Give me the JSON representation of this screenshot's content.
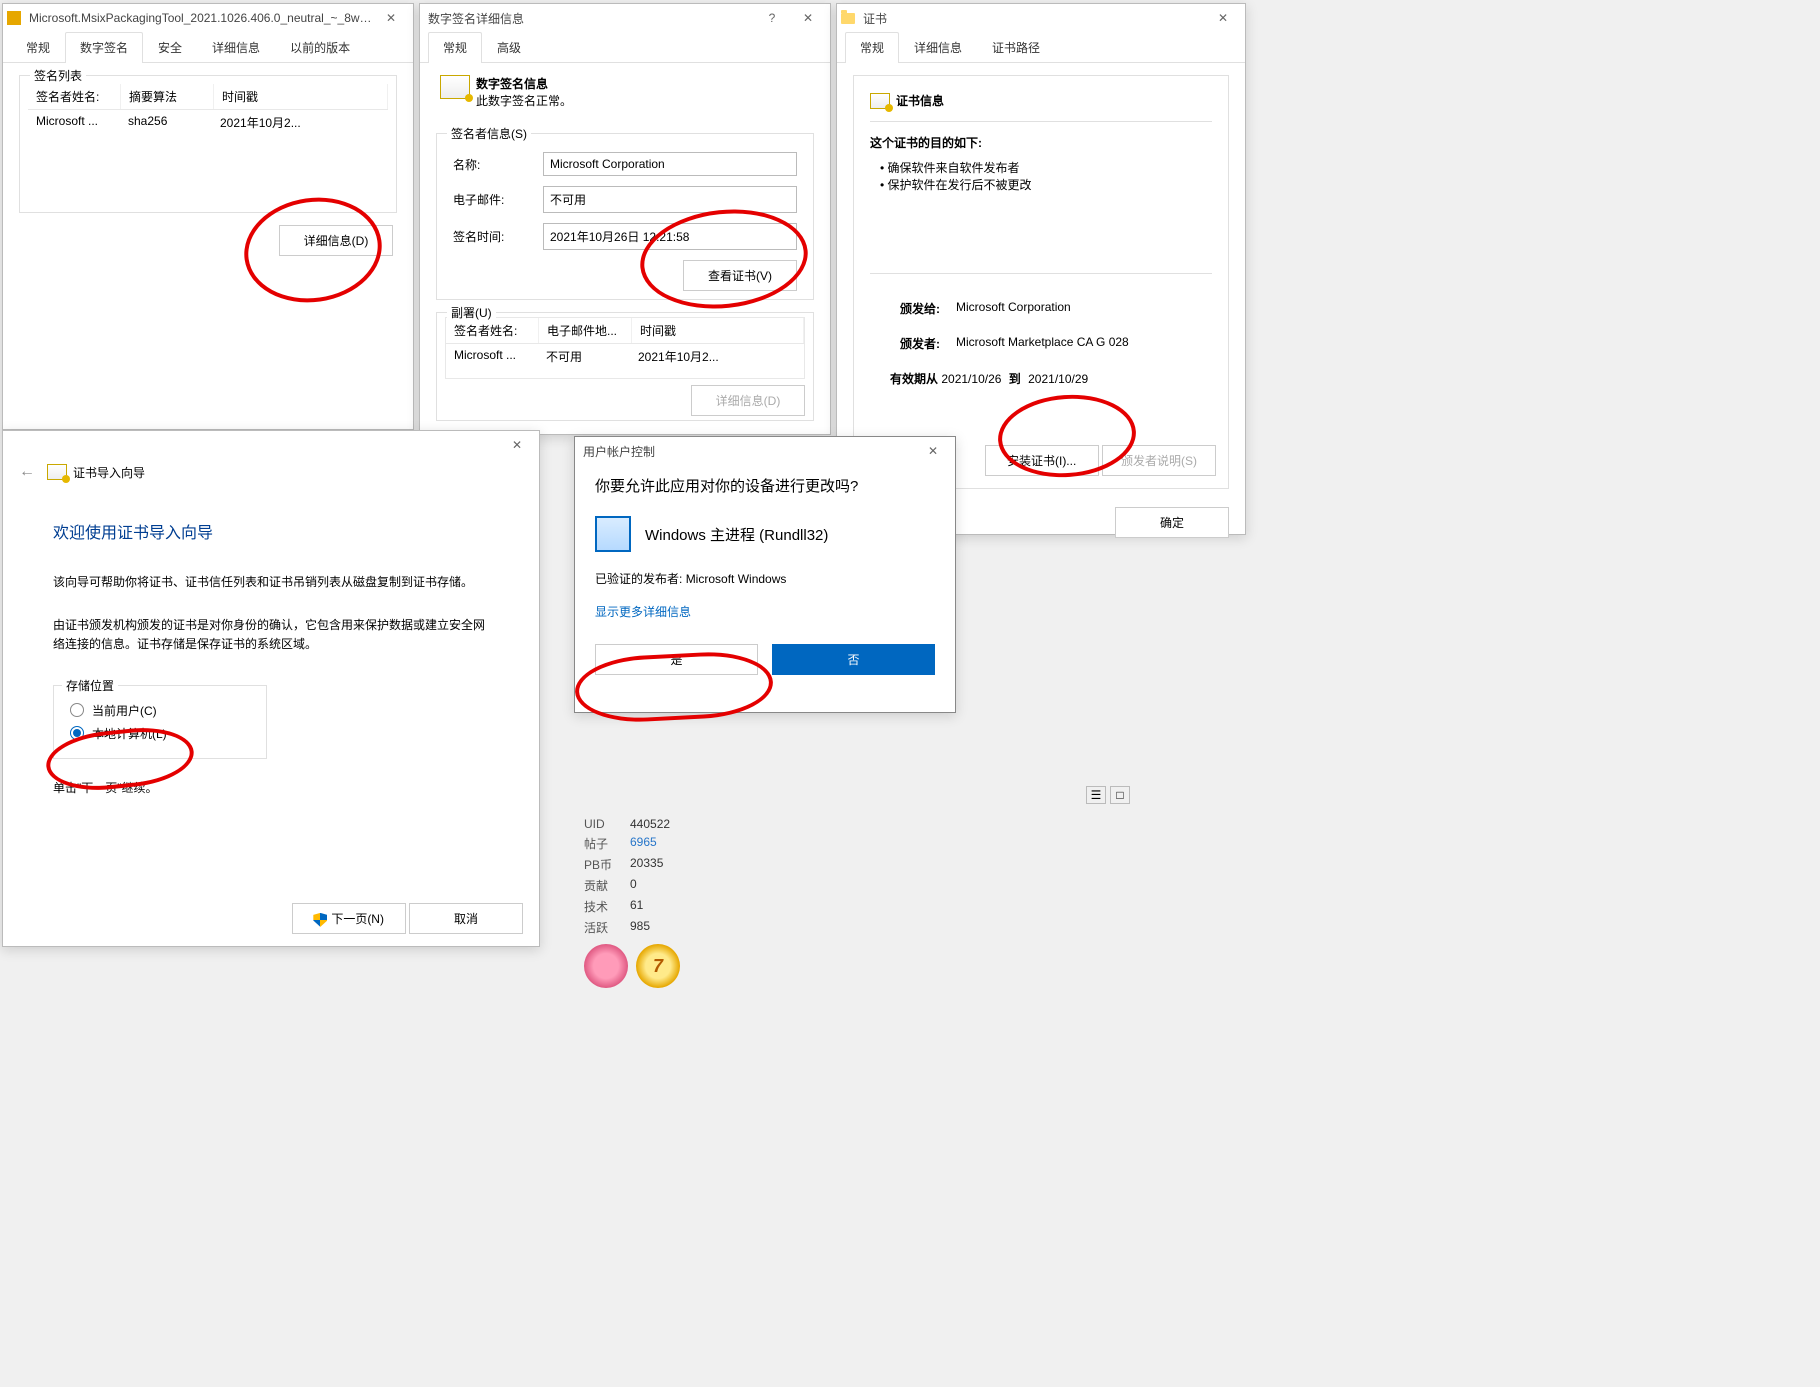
{
  "win1": {
    "title": "Microsoft.MsixPackagingTool_2021.1026.406.0_neutral_~_8wekyb3d8...",
    "tabs": [
      "常规",
      "数字签名",
      "安全",
      "详细信息",
      "以前的版本"
    ],
    "active_tab": 1,
    "group_title": "签名列表",
    "headers": [
      "签名者姓名:",
      "摘要算法",
      "时间戳"
    ],
    "row": [
      "Microsoft ...",
      "sha256",
      "2021年10月2..."
    ],
    "details_btn": "详细信息(D)"
  },
  "win2": {
    "title": "数字签名详细信息",
    "tabs": [
      "常规",
      "高级"
    ],
    "info_title": "数字签名信息",
    "info_text": "此数字签名正常。",
    "signer_group": "签名者信息(S)",
    "name_label": "名称:",
    "name_val": "Microsoft Corporation",
    "email_label": "电子邮件:",
    "email_val": "不可用",
    "time_label": "签名时间:",
    "time_val": "2021年10月26日 12:21:58",
    "view_cert_btn": "查看证书(V)",
    "counter_group": "副署(U)",
    "counter_headers": [
      "签名者姓名:",
      "电子邮件地...",
      "时间戳"
    ],
    "counter_row": [
      "Microsoft ...",
      "不可用",
      "2021年10月2..."
    ],
    "counter_details_btn": "详细信息(D)"
  },
  "win3": {
    "title": "证书",
    "tabs": [
      "常规",
      "详细信息",
      "证书路径"
    ],
    "cert_info_title": "证书信息",
    "purpose_title": "这个证书的目的如下:",
    "purpose_1": "确保软件来自软件发布者",
    "purpose_2": "保护软件在发行后不被更改",
    "issued_to_label": "颁发给:",
    "issued_to": "Microsoft Corporation",
    "issued_by_label": "颁发者:",
    "issued_by": "Microsoft Marketplace CA G 028",
    "valid_label": "有效期从",
    "valid_from": "2021/10/26",
    "valid_to_label": "到",
    "valid_to": "2021/10/29",
    "install_btn": "安装证书(I)...",
    "issuer_stmt_btn": "颁发者说明(S)",
    "ok_btn": "确定"
  },
  "win4": {
    "title": "证书导入向导",
    "heading": "欢迎使用证书导入向导",
    "para1": "该向导可帮助你将证书、证书信任列表和证书吊销列表从磁盘复制到证书存储。",
    "para2": "由证书颁发机构颁发的证书是对你身份的确认，它包含用来保护数据或建立安全网络连接的信息。证书存储是保存证书的系统区域。",
    "store_label": "存储位置",
    "opt_user": "当前用户(C)",
    "opt_machine": "本地计算机(L)",
    "continue_text": "单击\"下一页\"继续。",
    "next_btn": "下一页(N)",
    "cancel_btn": "取消"
  },
  "uac": {
    "title": "用户帐户控制",
    "question": "你要允许此应用对你的设备进行更改吗?",
    "app_name": "Windows 主进程 (Rundll32)",
    "publisher_label": "已验证的发布者:",
    "publisher": "Microsoft Windows",
    "more_link": "显示更多详细信息",
    "yes": "是",
    "no": "否"
  },
  "stats": {
    "uid_k": "UID",
    "uid_v": "440522",
    "posts_k": "帖子",
    "posts_v": "6965",
    "pb_k": "PB币",
    "pb_v": "20335",
    "contrib_k": "贡献",
    "contrib_v": "0",
    "tech_k": "技术",
    "tech_v": "61",
    "active_k": "活跃",
    "active_v": "985"
  }
}
